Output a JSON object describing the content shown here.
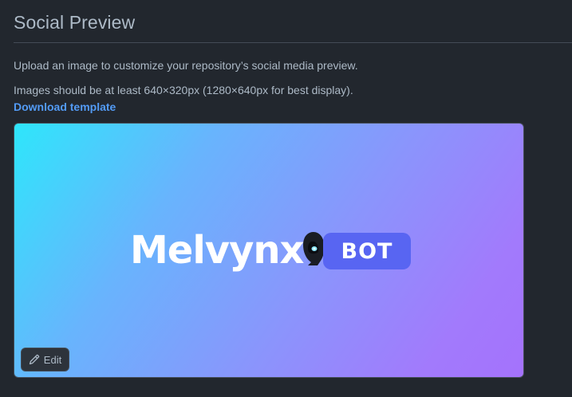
{
  "section": {
    "title": "Social Preview"
  },
  "description": "Upload an image to customize your repository’s social media preview.",
  "size_note": "Images should be at least 640×320px (1280×640px for best display).",
  "template_link": "Download template",
  "preview": {
    "brand_name": "Melvynx",
    "badge": "BOT",
    "gradient_colors": [
      "#2ee6fb",
      "#a472fc"
    ],
    "badge_color": "#5865f2",
    "mascot_icon": "hooded-mascot-icon"
  },
  "edit_button": {
    "label": "Edit",
    "icon": "pencil-icon"
  },
  "colors": {
    "background": "#22272e",
    "text": "#adbac7",
    "link": "#539bf5"
  }
}
